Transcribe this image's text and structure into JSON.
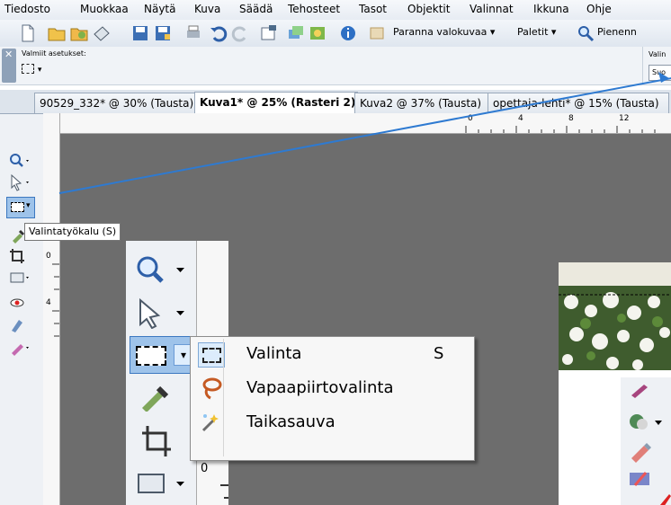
{
  "menubar": {
    "items": [
      "Tiedosto",
      "Muokkaa",
      "Näytä",
      "Kuva",
      "Säädä",
      "Tehosteet",
      "Tasot",
      "Objektit",
      "Valinnat",
      "Ikkuna",
      "Ohje"
    ]
  },
  "toolbar": {
    "enhance_label": "Paranna valokuvaa",
    "palettes_label": "Paletit",
    "shrink_label": "Pienenn"
  },
  "presetbar": {
    "presets_label": "Valmiit asetukset:",
    "right_label": "Valin",
    "right_button": "Suo"
  },
  "tabs": [
    {
      "label": "90529_332* @ 30% (Tausta)",
      "active": false
    },
    {
      "label": "Kuva1* @ 25% (Rasteri 2)",
      "active": true
    },
    {
      "label": "Kuva2 @ 37% (Tausta)",
      "active": false
    },
    {
      "label": "opettaja-lehti* @ 15% (Tausta)",
      "active": false
    }
  ],
  "ruler": {
    "top_ticks": [
      "0",
      "4",
      "8",
      "12"
    ],
    "left_ticks": [
      "0",
      "4"
    ],
    "zoom_left_tick": "0"
  },
  "tooltip": {
    "text": "Valintatyökalu (S)"
  },
  "selection_menu": {
    "items": [
      {
        "label": "Valinta",
        "shortcut": "S",
        "icon": "rectangle-selection-icon"
      },
      {
        "label": "Vapaapiirtovalinta",
        "shortcut": "",
        "icon": "lasso-icon"
      },
      {
        "label": "Taikasauva",
        "shortcut": "",
        "icon": "magic-wand-icon"
      }
    ]
  },
  "colors": {
    "arrow": "#2e7ad1",
    "canvas": "#6d6d6d",
    "menu_bg": "#f7f7f7"
  }
}
